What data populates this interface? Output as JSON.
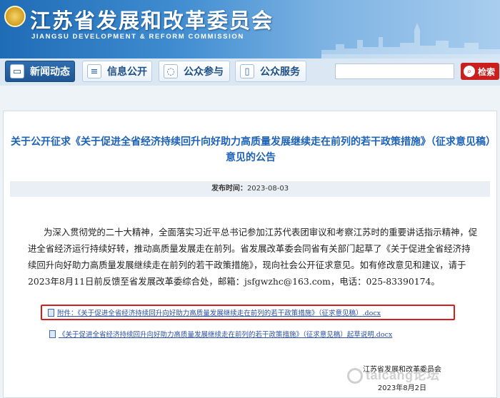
{
  "header": {
    "title": "江苏省发展和改革委员会",
    "subtitle": "JIANGSU DEVELOPMENT & REFORM COMMISSION"
  },
  "nav": {
    "items": [
      {
        "label": "新闻动态",
        "icon": "monitor-icon",
        "active": true
      },
      {
        "label": "信息公开",
        "icon": "document-icon",
        "active": false
      },
      {
        "label": "公众参与",
        "icon": "chat-icon",
        "active": false
      },
      {
        "label": "公众服务",
        "icon": "book-icon",
        "active": false
      }
    ],
    "search_placeholder": "",
    "search_label": "检索"
  },
  "article": {
    "title": "关于公开征求《关于促进全省经济持续回升向好助力高质量发展继续走在前列的若干政策措施》（征求意见稿）意见的公告",
    "meta_label": "发布时间：",
    "meta_date": "2023-08-03",
    "body": "为深入贯彻党的二十大精神，全面落实习近平总书记参加江苏代表团审议和考察江苏时的重要讲话指示精神，促进全省经济运行持续好转，推动高质量发展走在前列。省发展改革委会同省有关部门起草了《关于促进全省经济持续回升向好助力高质量发展继续走在前列的若干政策措施》，现向社会公开征求意见。如有修改意见和建议，请于2023年8月11日前反馈至省发展改革委综合处，邮箱：jsfgwzhc@163.com，电话：025-83390174。",
    "attachment1": "附件：《关于促进全省经济持续回升向好助力高质量发展继续走在前列的若干政策措施》（征求意见稿）.docx",
    "attachment2": "《关于促进全省经济持续回升向好助力高质量发展继续走在前列的若干政策措施》（征求意见稿）起草说明.docx",
    "signature": "江苏省发展和改革委员会",
    "sign_date": "2023年8月2日"
  },
  "watermark": "taicang论坛",
  "colors": {
    "brand_blue": "#1f5592",
    "title_blue": "#1d62b5",
    "search_red": "#c9201e",
    "highlight_red": "#d61e1e"
  }
}
